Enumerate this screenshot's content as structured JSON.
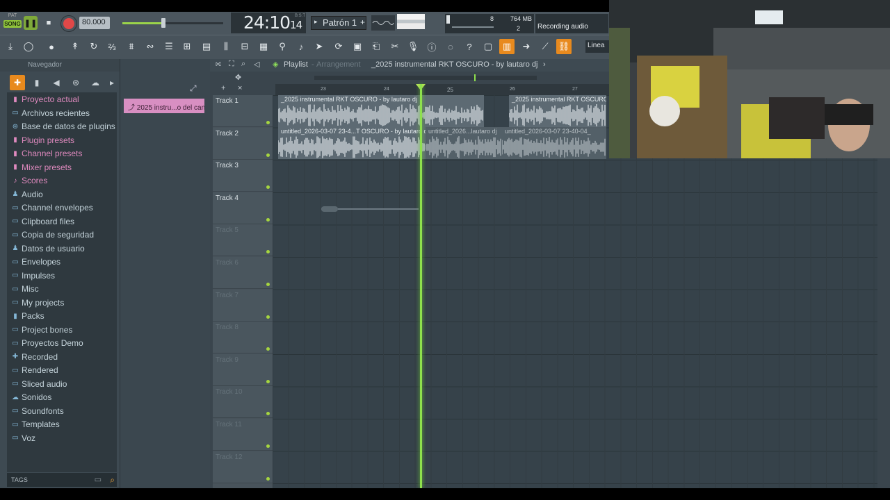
{
  "transport": {
    "pat_label": "PAT",
    "song_label": "SONG",
    "tempo": "80.000",
    "time_main": "24:10",
    "time_sub": "14",
    "time_unit": "B:S:T",
    "pattern": "Patrón 1",
    "cpu_value": "8",
    "mem_value": "764 MB",
    "poly_value": "2",
    "recording_status": "Recording audio",
    "linea_label": "Linea"
  },
  "browser": {
    "title": "Navegador",
    "items": [
      {
        "label": "Proyecto actual",
        "icon": "project-icon",
        "tone": "pink"
      },
      {
        "label": "Archivos recientes",
        "icon": "recent-files-icon",
        "tone": "blue"
      },
      {
        "label": "Base de datos de plugins",
        "icon": "plugin-db-icon",
        "tone": "blue"
      },
      {
        "label": "Plugin presets",
        "icon": "plugin-presets-icon",
        "tone": "pink"
      },
      {
        "label": "Channel presets",
        "icon": "channel-presets-icon",
        "tone": "pink"
      },
      {
        "label": "Mixer presets",
        "icon": "mixer-presets-icon",
        "tone": "pink"
      },
      {
        "label": "Scores",
        "icon": "note-icon",
        "tone": "pink"
      },
      {
        "label": "Audio",
        "icon": "speaker-icon",
        "tone": "blue"
      },
      {
        "label": "Channel envelopes",
        "icon": "envelope-icon",
        "tone": "blue"
      },
      {
        "label": "Clipboard files",
        "icon": "folder-icon",
        "tone": "blue"
      },
      {
        "label": "Copia de seguridad",
        "icon": "backup-icon",
        "tone": "blue"
      },
      {
        "label": "Datos de usuario",
        "icon": "user-icon",
        "tone": "blue"
      },
      {
        "label": "Envelopes",
        "icon": "folder-icon",
        "tone": "blue"
      },
      {
        "label": "Impulses",
        "icon": "folder-icon",
        "tone": "blue"
      },
      {
        "label": "Misc",
        "icon": "folder-icon",
        "tone": "blue"
      },
      {
        "label": "My projects",
        "icon": "folder-icon",
        "tone": "blue"
      },
      {
        "label": "Packs",
        "icon": "packs-icon",
        "tone": "blue"
      },
      {
        "label": "Project bones",
        "icon": "folder-icon",
        "tone": "blue"
      },
      {
        "label": "Proyectos Demo",
        "icon": "folder-icon",
        "tone": "blue"
      },
      {
        "label": "Recorded",
        "icon": "recorded-icon",
        "tone": "blue"
      },
      {
        "label": "Rendered",
        "icon": "folder-icon",
        "tone": "blue"
      },
      {
        "label": "Sliced audio",
        "icon": "folder-icon",
        "tone": "blue"
      },
      {
        "label": "Sonidos",
        "icon": "cloud-icon",
        "tone": "blue"
      },
      {
        "label": "Soundfonts",
        "icon": "folder-icon",
        "tone": "blue"
      },
      {
        "label": "Templates",
        "icon": "folder-icon",
        "tone": "blue"
      },
      {
        "label": "Voz",
        "icon": "folder-icon",
        "tone": "blue"
      }
    ],
    "tags_label": "TAGS"
  },
  "channel": {
    "clip_name": "2025 instru...o del canal"
  },
  "playlist": {
    "title": "Playlist",
    "subtitle": "Arrangement",
    "arrangement_name": "_2025 instrumental RKT OSCURO - by lautaro dj",
    "ruler": [
      "23",
      "24",
      "25",
      "26",
      "27"
    ],
    "tracks": [
      "Track 1",
      "Track 2",
      "Track 3",
      "Track 4",
      "Track 5",
      "Track 6",
      "Track 7",
      "Track 8",
      "Track 9",
      "Track 10",
      "Track 11",
      "Track 12"
    ],
    "clips": {
      "t1a": "_2025 instrumental RKT OSCURO - by lautaro dj",
      "t1b": "_2025 instrumental RKT OSCURO",
      "t2a": "untitled_2026-03-07 23-4...T OSCURO - by lautaro dj",
      "t2b": "untitled_2026...lautaro dj",
      "t2c": "untitled_2026-03-07 23-40-04_"
    }
  },
  "colors": {
    "accent": "#e88a1e",
    "playhead": "#8ee04d",
    "clip_pink": "#d88fc2"
  }
}
